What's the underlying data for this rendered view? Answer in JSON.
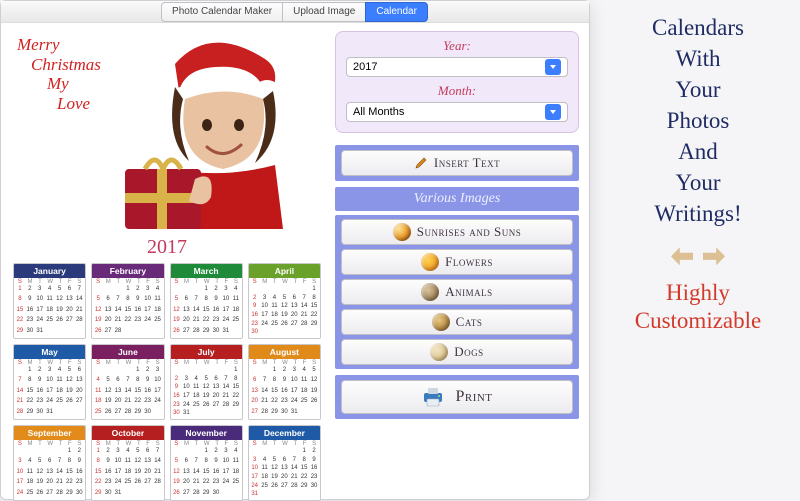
{
  "tabs": [
    "Photo Calendar Maker",
    "Upload Image",
    "Calendar"
  ],
  "active_tab_index": 2,
  "overlay": {
    "l1": "Merry",
    "l2": "Christmas",
    "l3": "My",
    "l4": "Love"
  },
  "year_display": "2017",
  "selectors": {
    "year_label": "Year:",
    "year_value": "2017",
    "month_label": "Month:",
    "month_value": "All Months"
  },
  "buttons": {
    "insert_text": "Insert Text",
    "various_images": "Various Images",
    "sunrises": "Sunrises and Suns",
    "flowers": "Flowers",
    "animals": "Animals",
    "cats": "Cats",
    "dogs": "Dogs",
    "print": "Print"
  },
  "months": [
    {
      "name": "January",
      "color": "#2b3a7a",
      "start": 0,
      "days": 31
    },
    {
      "name": "February",
      "color": "#6a2a7a",
      "start": 3,
      "days": 28
    },
    {
      "name": "March",
      "color": "#1e8a3a",
      "start": 3,
      "days": 31
    },
    {
      "name": "April",
      "color": "#6aa12a",
      "start": 6,
      "days": 30
    },
    {
      "name": "May",
      "color": "#1e5aa6",
      "start": 1,
      "days": 31
    },
    {
      "name": "June",
      "color": "#7a1f5f",
      "start": 4,
      "days": 30
    },
    {
      "name": "July",
      "color": "#b51f1f",
      "start": 6,
      "days": 31
    },
    {
      "name": "August",
      "color": "#e08a1a",
      "start": 2,
      "days": 31
    },
    {
      "name": "September",
      "color": "#e28a1a",
      "start": 5,
      "days": 30
    },
    {
      "name": "October",
      "color": "#b51f1f",
      "start": 0,
      "days": 31
    },
    {
      "name": "November",
      "color": "#4a2a7a",
      "start": 3,
      "days": 30
    },
    {
      "name": "December",
      "color": "#1e5aa6",
      "start": 5,
      "days": 31
    }
  ],
  "weekday_letters": [
    "S",
    "M",
    "T",
    "W",
    "T",
    "F",
    "S"
  ],
  "promo": {
    "main": "Calendars With Your Photos And Your Writings!",
    "sub1": "Highly",
    "sub2": "Customizable"
  }
}
